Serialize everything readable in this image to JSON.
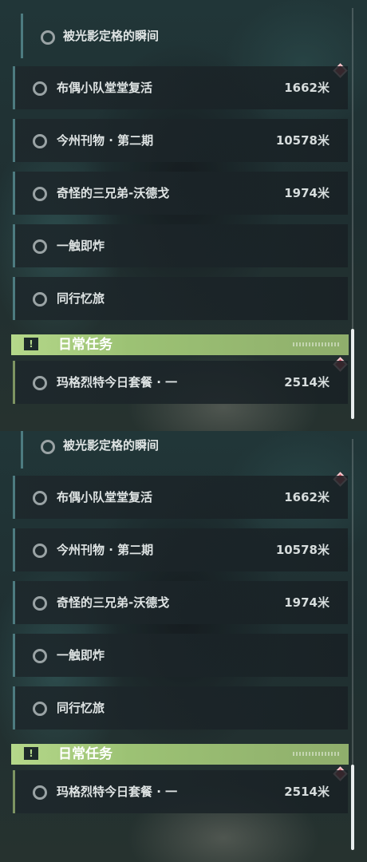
{
  "quest_list": {
    "side_quests": [
      {
        "title": "被光影定格的瞬间",
        "distance": "",
        "sub": true
      },
      {
        "title": "布偶小队堂堂复活",
        "distance": "1662米"
      },
      {
        "title": "今州刊物 · 第二期",
        "distance": "10578米"
      },
      {
        "title": "奇怪的三兄弟-沃德戈",
        "distance": "1974米"
      },
      {
        "title": "一触即炸",
        "distance": ""
      },
      {
        "title": "同行忆旅",
        "distance": ""
      }
    ],
    "daily_section": {
      "title": "日常任务",
      "icon": "exclamation-icon",
      "items": [
        {
          "title": "玛格烈特今日套餐 · 一",
          "distance": "2514米"
        }
      ]
    }
  },
  "colors": {
    "tracked_marker": "#d64b5b",
    "daily_accent": "#b5d88a",
    "quest_bar": "#4d7b80"
  }
}
